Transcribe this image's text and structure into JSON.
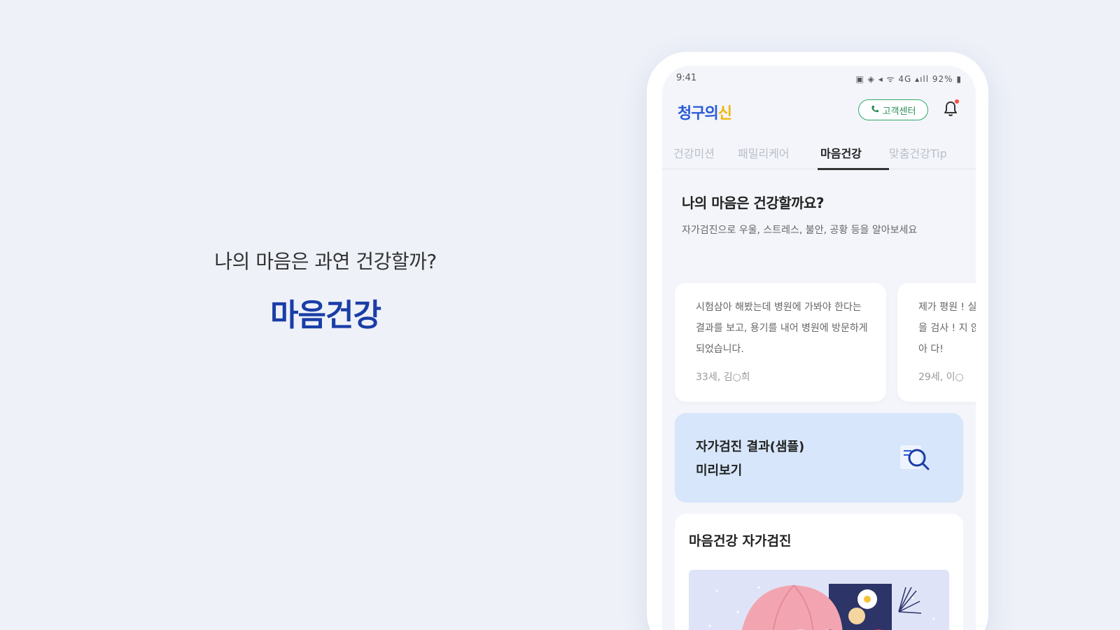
{
  "hero": {
    "subtitle": "나의 마음은 과연 건강할까?",
    "title": "마음건강"
  },
  "phone": {
    "status_bar": {
      "time": "9:41",
      "indicators": "▣ ◈ ◂ ᯤ 4G ▴ıll 92% ▮",
      "battery": "92%"
    },
    "app_bar": {
      "logo_main": "청구의",
      "logo_accent": "신",
      "customer_center": "고객센터",
      "notification_dot": true
    },
    "tabs": [
      {
        "label": "건강미션",
        "active": false
      },
      {
        "label": "패밀리케어",
        "active": false
      },
      {
        "label": "마음건강",
        "active": true
      },
      {
        "label": "맞춤건강Tip",
        "active": false
      }
    ],
    "intro": {
      "title": "나의 마음은 건강할까요?",
      "description": "자가검진으로 우울, 스트레스, 불안, 공황 등을 알아보세요"
    },
    "reviews": [
      {
        "text": "시험삼아 해봤는데 병원에 가봐야 한다는 결과를 보고, 용기를 내어 병원에 방문하게 되었습니다.",
        "author": "33세, 김○희"
      },
      {
        "text": "제가 평원 ! 실을 검사 ! 지 않아 다!",
        "author": "29세, 이○"
      }
    ],
    "preview_card": {
      "title": "자가검진 결과(샘플)\n미리보기"
    },
    "checkup": {
      "title": "마음건강 자가검진"
    }
  },
  "colors": {
    "background": "#eef1f8",
    "brand_blue": "#1a3da6",
    "logo_blue": "#2a5bd7",
    "logo_yellow": "#f2b60a",
    "cs_green": "#2fa86d",
    "preview_bg": "#d7e6fa"
  },
  "icons": [
    "phone-icon",
    "bell-icon",
    "search-icon",
    "battery-icon",
    "signal-icon"
  ]
}
